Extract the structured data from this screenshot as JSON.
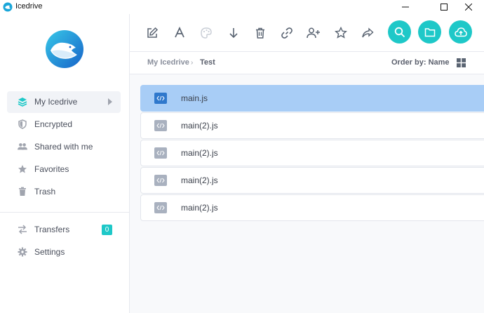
{
  "window": {
    "title": "Icedrive",
    "controls": [
      "minimize",
      "maximize",
      "close"
    ]
  },
  "sidebar": {
    "items": [
      {
        "label": "My Icedrive",
        "icon": "layers-icon",
        "active": true
      },
      {
        "label": "Encrypted",
        "icon": "shield-icon"
      },
      {
        "label": "Shared with me",
        "icon": "users-icon"
      },
      {
        "label": "Favorites",
        "icon": "star-icon"
      },
      {
        "label": "Trash",
        "icon": "trash-icon"
      }
    ],
    "bottom_items": [
      {
        "label": "Transfers",
        "icon": "transfer-icon",
        "badge": "0"
      },
      {
        "label": "Settings",
        "icon": "gear-icon"
      }
    ]
  },
  "toolbar": {
    "buttons": [
      "edit-icon",
      "rename-icon",
      "color-palette-icon",
      "download-icon",
      "delete-icon",
      "link-icon",
      "share-user-icon",
      "favorite-icon",
      "forward-icon"
    ],
    "circle_buttons": [
      "search-icon",
      "folder-icon",
      "upload-cloud-icon"
    ]
  },
  "breadcrumb": {
    "root": "My Icedrive",
    "separator": "›",
    "current": "Test"
  },
  "sort": {
    "label": "Order by: Name"
  },
  "files": [
    {
      "name": "main.js",
      "selected": true
    },
    {
      "name": "main(2).js"
    },
    {
      "name": "main(2).js"
    },
    {
      "name": "main(2).js"
    },
    {
      "name": "main(2).js"
    }
  ],
  "colors": {
    "accent": "#1ec8c8",
    "selected_row": "#a8cdf6",
    "selected_icon": "#2f78cc",
    "file_icon": "#a9b1bf"
  }
}
